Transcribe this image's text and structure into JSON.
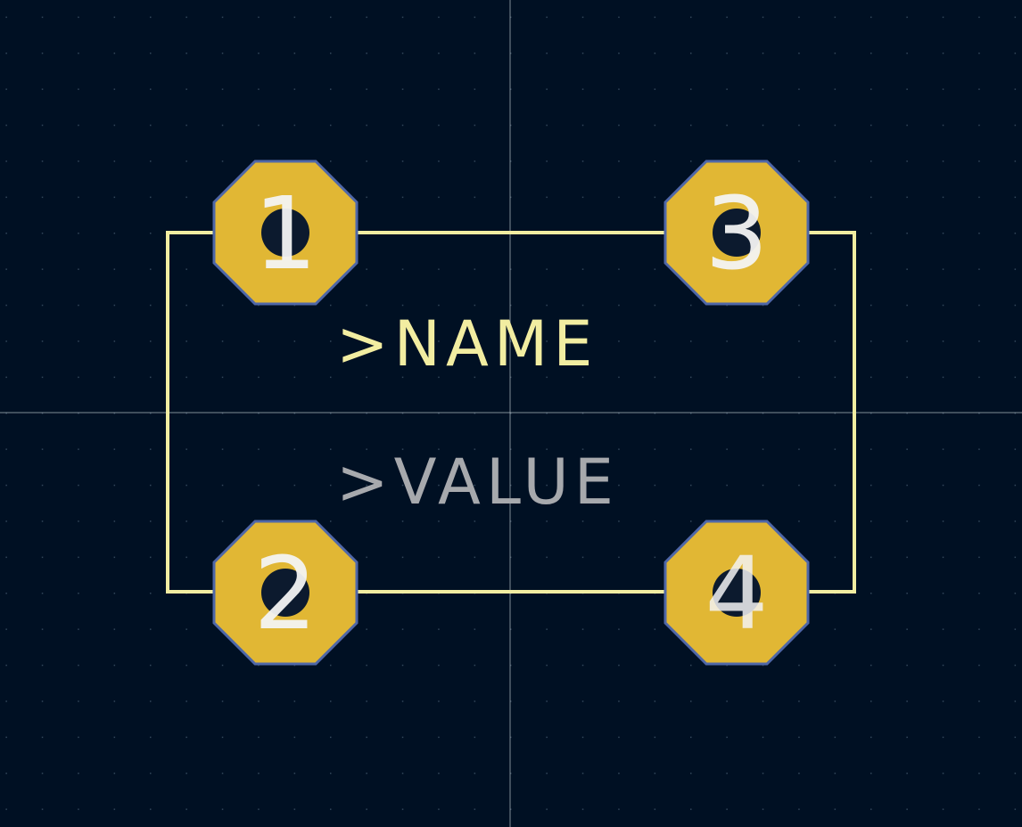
{
  "footprint": {
    "pads": [
      {
        "number": "1"
      },
      {
        "number": "2"
      },
      {
        "number": "3"
      },
      {
        "number": "4"
      }
    ],
    "name_text": ">NAME",
    "value_text": ">VALUE"
  },
  "colors": {
    "background": "#001023",
    "grid_dot": "#32465a",
    "crosshair": "#b8c0c8",
    "silkscreen": "#f2eda1",
    "value_text": "#a7a9ad",
    "pad_fill": "#e1b734",
    "pad_outline": "#4f67a8",
    "drill_hole": "#0c1a2e",
    "pad_number": "#f3f3f3"
  }
}
